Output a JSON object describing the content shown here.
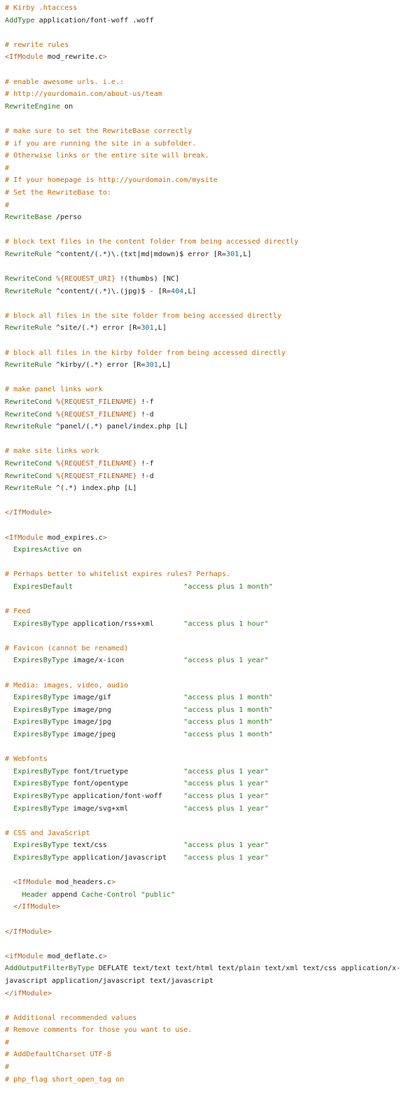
{
  "file": {
    "lines": [
      [
        [
          "c",
          "# Kirby .htaccess"
        ]
      ],
      [
        [
          "k",
          "AddType"
        ],
        [
          "p",
          " application/font-woff .woff"
        ]
      ],
      [],
      [
        [
          "c",
          "# rewrite rules"
        ]
      ],
      [
        [
          "t",
          "<IfModule"
        ],
        [
          "p",
          " mod_rewrite.c"
        ],
        [
          "t",
          ">"
        ]
      ],
      [],
      [
        [
          "c",
          "# enable awesome urls. i.e.:"
        ]
      ],
      [
        [
          "c",
          "# http://yourdomain.com/about-us/team"
        ]
      ],
      [
        [
          "k",
          "RewriteEngine"
        ],
        [
          "p",
          " on"
        ]
      ],
      [],
      [
        [
          "c",
          "# make sure to set the RewriteBase correctly"
        ]
      ],
      [
        [
          "c",
          "# if you are running the site in a subfolder."
        ]
      ],
      [
        [
          "c",
          "# Otherwise links or the entire site will break."
        ]
      ],
      [
        [
          "c",
          "#"
        ]
      ],
      [
        [
          "c",
          "# If your homepage is http://yourdomain.com/mysite"
        ]
      ],
      [
        [
          "c",
          "# Set the RewriteBase to:"
        ]
      ],
      [
        [
          "c",
          "#"
        ]
      ],
      [
        [
          "k",
          "RewriteBase"
        ],
        [
          "p",
          " /perso"
        ]
      ],
      [],
      [
        [
          "c",
          "# block text files in the content folder from being accessed directly"
        ]
      ],
      [
        [
          "k",
          "RewriteRule"
        ],
        [
          "p",
          " ^content/(.*)\\.(txt|md|mdown)$ error [R="
        ],
        [
          "n",
          "301"
        ],
        [
          "p",
          ",L]"
        ]
      ],
      [],
      [
        [
          "k",
          "RewriteCond"
        ],
        [
          "p",
          " "
        ],
        [
          "v",
          "%{REQUEST_URI}"
        ],
        [
          "p",
          " !(thumbs) [NC]"
        ]
      ],
      [
        [
          "k",
          "RewriteRule"
        ],
        [
          "p",
          " ^content/(.*)\\.(jpg)$ - [R="
        ],
        [
          "n",
          "404"
        ],
        [
          "p",
          ",L]"
        ]
      ],
      [],
      [
        [
          "c",
          "# block all files in the site folder from being accessed directly"
        ]
      ],
      [
        [
          "k",
          "RewriteRule"
        ],
        [
          "p",
          " ^site/(.*) error [R="
        ],
        [
          "n",
          "301"
        ],
        [
          "p",
          ",L]"
        ]
      ],
      [],
      [
        [
          "c",
          "# block all files in the kirby folder from being accessed directly"
        ]
      ],
      [
        [
          "k",
          "RewriteRule"
        ],
        [
          "p",
          " ^kirby/(.*) error [R="
        ],
        [
          "n",
          "301"
        ],
        [
          "p",
          ",L]"
        ]
      ],
      [],
      [
        [
          "c",
          "# make panel links work"
        ]
      ],
      [
        [
          "k",
          "RewriteCond"
        ],
        [
          "p",
          " "
        ],
        [
          "v",
          "%{REQUEST_FILENAME}"
        ],
        [
          "p",
          " !-f"
        ]
      ],
      [
        [
          "k",
          "RewriteCond"
        ],
        [
          "p",
          " "
        ],
        [
          "v",
          "%{REQUEST_FILENAME}"
        ],
        [
          "p",
          " !-d"
        ]
      ],
      [
        [
          "k",
          "RewriteRule"
        ],
        [
          "p",
          " ^panel/(.*) panel/index.php [L]"
        ]
      ],
      [],
      [
        [
          "c",
          "# make site links work"
        ]
      ],
      [
        [
          "k",
          "RewriteCond"
        ],
        [
          "p",
          " "
        ],
        [
          "v",
          "%{REQUEST_FILENAME}"
        ],
        [
          "p",
          " !-f"
        ]
      ],
      [
        [
          "k",
          "RewriteCond"
        ],
        [
          "p",
          " "
        ],
        [
          "v",
          "%{REQUEST_FILENAME}"
        ],
        [
          "p",
          " !-d"
        ]
      ],
      [
        [
          "k",
          "RewriteRule"
        ],
        [
          "p",
          " ^(.*) index.php [L]"
        ]
      ],
      [],
      [
        [
          "t",
          "</IfModule>"
        ]
      ],
      [],
      [
        [
          "t",
          "<IfModule"
        ],
        [
          "p",
          " mod_expires.c"
        ],
        [
          "t",
          ">"
        ]
      ],
      [
        [
          "p",
          "  "
        ],
        [
          "k",
          "ExpiresActive"
        ],
        [
          "p",
          " on"
        ]
      ],
      [],
      [
        [
          "c",
          "# Perhaps better to whitelist expires rules? Perhaps."
        ]
      ],
      [
        [
          "p",
          "  "
        ],
        [
          "k",
          "ExpiresDefault"
        ],
        [
          "p",
          "                          "
        ],
        [
          "s",
          "\"access plus 1 month\""
        ]
      ],
      [],
      [
        [
          "c",
          "# Feed"
        ]
      ],
      [
        [
          "p",
          "  "
        ],
        [
          "k",
          "ExpiresByType"
        ],
        [
          "p",
          " application/rss+xml       "
        ],
        [
          "s",
          "\"access plus 1 hour\""
        ]
      ],
      [],
      [
        [
          "c",
          "# Favicon (cannot be renamed)"
        ]
      ],
      [
        [
          "p",
          "  "
        ],
        [
          "k",
          "ExpiresByType"
        ],
        [
          "p",
          " image/x-icon              "
        ],
        [
          "s",
          "\"access plus 1 year\""
        ]
      ],
      [],
      [
        [
          "c",
          "# Media: images, video, audio"
        ]
      ],
      [
        [
          "p",
          "  "
        ],
        [
          "k",
          "ExpiresByType"
        ],
        [
          "p",
          " image/gif                 "
        ],
        [
          "s",
          "\"access plus 1 month\""
        ]
      ],
      [
        [
          "p",
          "  "
        ],
        [
          "k",
          "ExpiresByType"
        ],
        [
          "p",
          " image/png                 "
        ],
        [
          "s",
          "\"access plus 1 month\""
        ]
      ],
      [
        [
          "p",
          "  "
        ],
        [
          "k",
          "ExpiresByType"
        ],
        [
          "p",
          " image/jpg                 "
        ],
        [
          "s",
          "\"access plus 1 month\""
        ]
      ],
      [
        [
          "p",
          "  "
        ],
        [
          "k",
          "ExpiresByType"
        ],
        [
          "p",
          " image/jpeg                "
        ],
        [
          "s",
          "\"access plus 1 month\""
        ]
      ],
      [],
      [
        [
          "c",
          "# Webfonts"
        ]
      ],
      [
        [
          "p",
          "  "
        ],
        [
          "k",
          "ExpiresByType"
        ],
        [
          "p",
          " font/truetype             "
        ],
        [
          "s",
          "\"access plus 1 year\""
        ]
      ],
      [
        [
          "p",
          "  "
        ],
        [
          "k",
          "ExpiresByType"
        ],
        [
          "p",
          " font/opentype             "
        ],
        [
          "s",
          "\"access plus 1 year\""
        ]
      ],
      [
        [
          "p",
          "  "
        ],
        [
          "k",
          "ExpiresByType"
        ],
        [
          "p",
          " application/font-woff     "
        ],
        [
          "s",
          "\"access plus 1 year\""
        ]
      ],
      [
        [
          "p",
          "  "
        ],
        [
          "k",
          "ExpiresByType"
        ],
        [
          "p",
          " image/svg+xml             "
        ],
        [
          "s",
          "\"access plus 1 year\""
        ]
      ],
      [],
      [
        [
          "c",
          "# CSS and JavaScript"
        ]
      ],
      [
        [
          "p",
          "  "
        ],
        [
          "k",
          "ExpiresByType"
        ],
        [
          "p",
          " text/css                  "
        ],
        [
          "s",
          "\"access plus 1 year\""
        ]
      ],
      [
        [
          "p",
          "  "
        ],
        [
          "k",
          "ExpiresByType"
        ],
        [
          "p",
          " application/javascript    "
        ],
        [
          "s",
          "\"access plus 1 year\""
        ]
      ],
      [],
      [
        [
          "p",
          "  "
        ],
        [
          "t",
          "<IfModule"
        ],
        [
          "p",
          " mod_headers.c"
        ],
        [
          "t",
          ">"
        ]
      ],
      [
        [
          "p",
          "    "
        ],
        [
          "k",
          "Header"
        ],
        [
          "p",
          " append "
        ],
        [
          "k",
          "Cache-Control"
        ],
        [
          "p",
          " "
        ],
        [
          "s",
          "\"public\""
        ]
      ],
      [
        [
          "p",
          "  "
        ],
        [
          "t",
          "</IfModule>"
        ]
      ],
      [],
      [
        [
          "t",
          "</IfModule>"
        ]
      ],
      [],
      [
        [
          "t",
          "<ifModule"
        ],
        [
          "p",
          " mod_deflate.c"
        ],
        [
          "t",
          ">"
        ]
      ],
      [
        [
          "k",
          "AddOutputFilterByType"
        ],
        [
          "p",
          " DEFLATE text/text text/html text/plain text/xml text/css application/x-"
        ]
      ],
      [
        [
          "p",
          "javascript application/javascript text/javascript"
        ]
      ],
      [
        [
          "t",
          "</ifModule>"
        ]
      ],
      [],
      [
        [
          "c",
          "# Additional recommended values"
        ]
      ],
      [
        [
          "c",
          "# Remove comments for those you want to use."
        ]
      ],
      [
        [
          "c",
          "#"
        ]
      ],
      [
        [
          "c",
          "# AddDefaultCharset UTF-8"
        ]
      ],
      [
        [
          "c",
          "#"
        ]
      ],
      [
        [
          "c",
          "# php_flag short_open_tag on"
        ]
      ]
    ]
  }
}
